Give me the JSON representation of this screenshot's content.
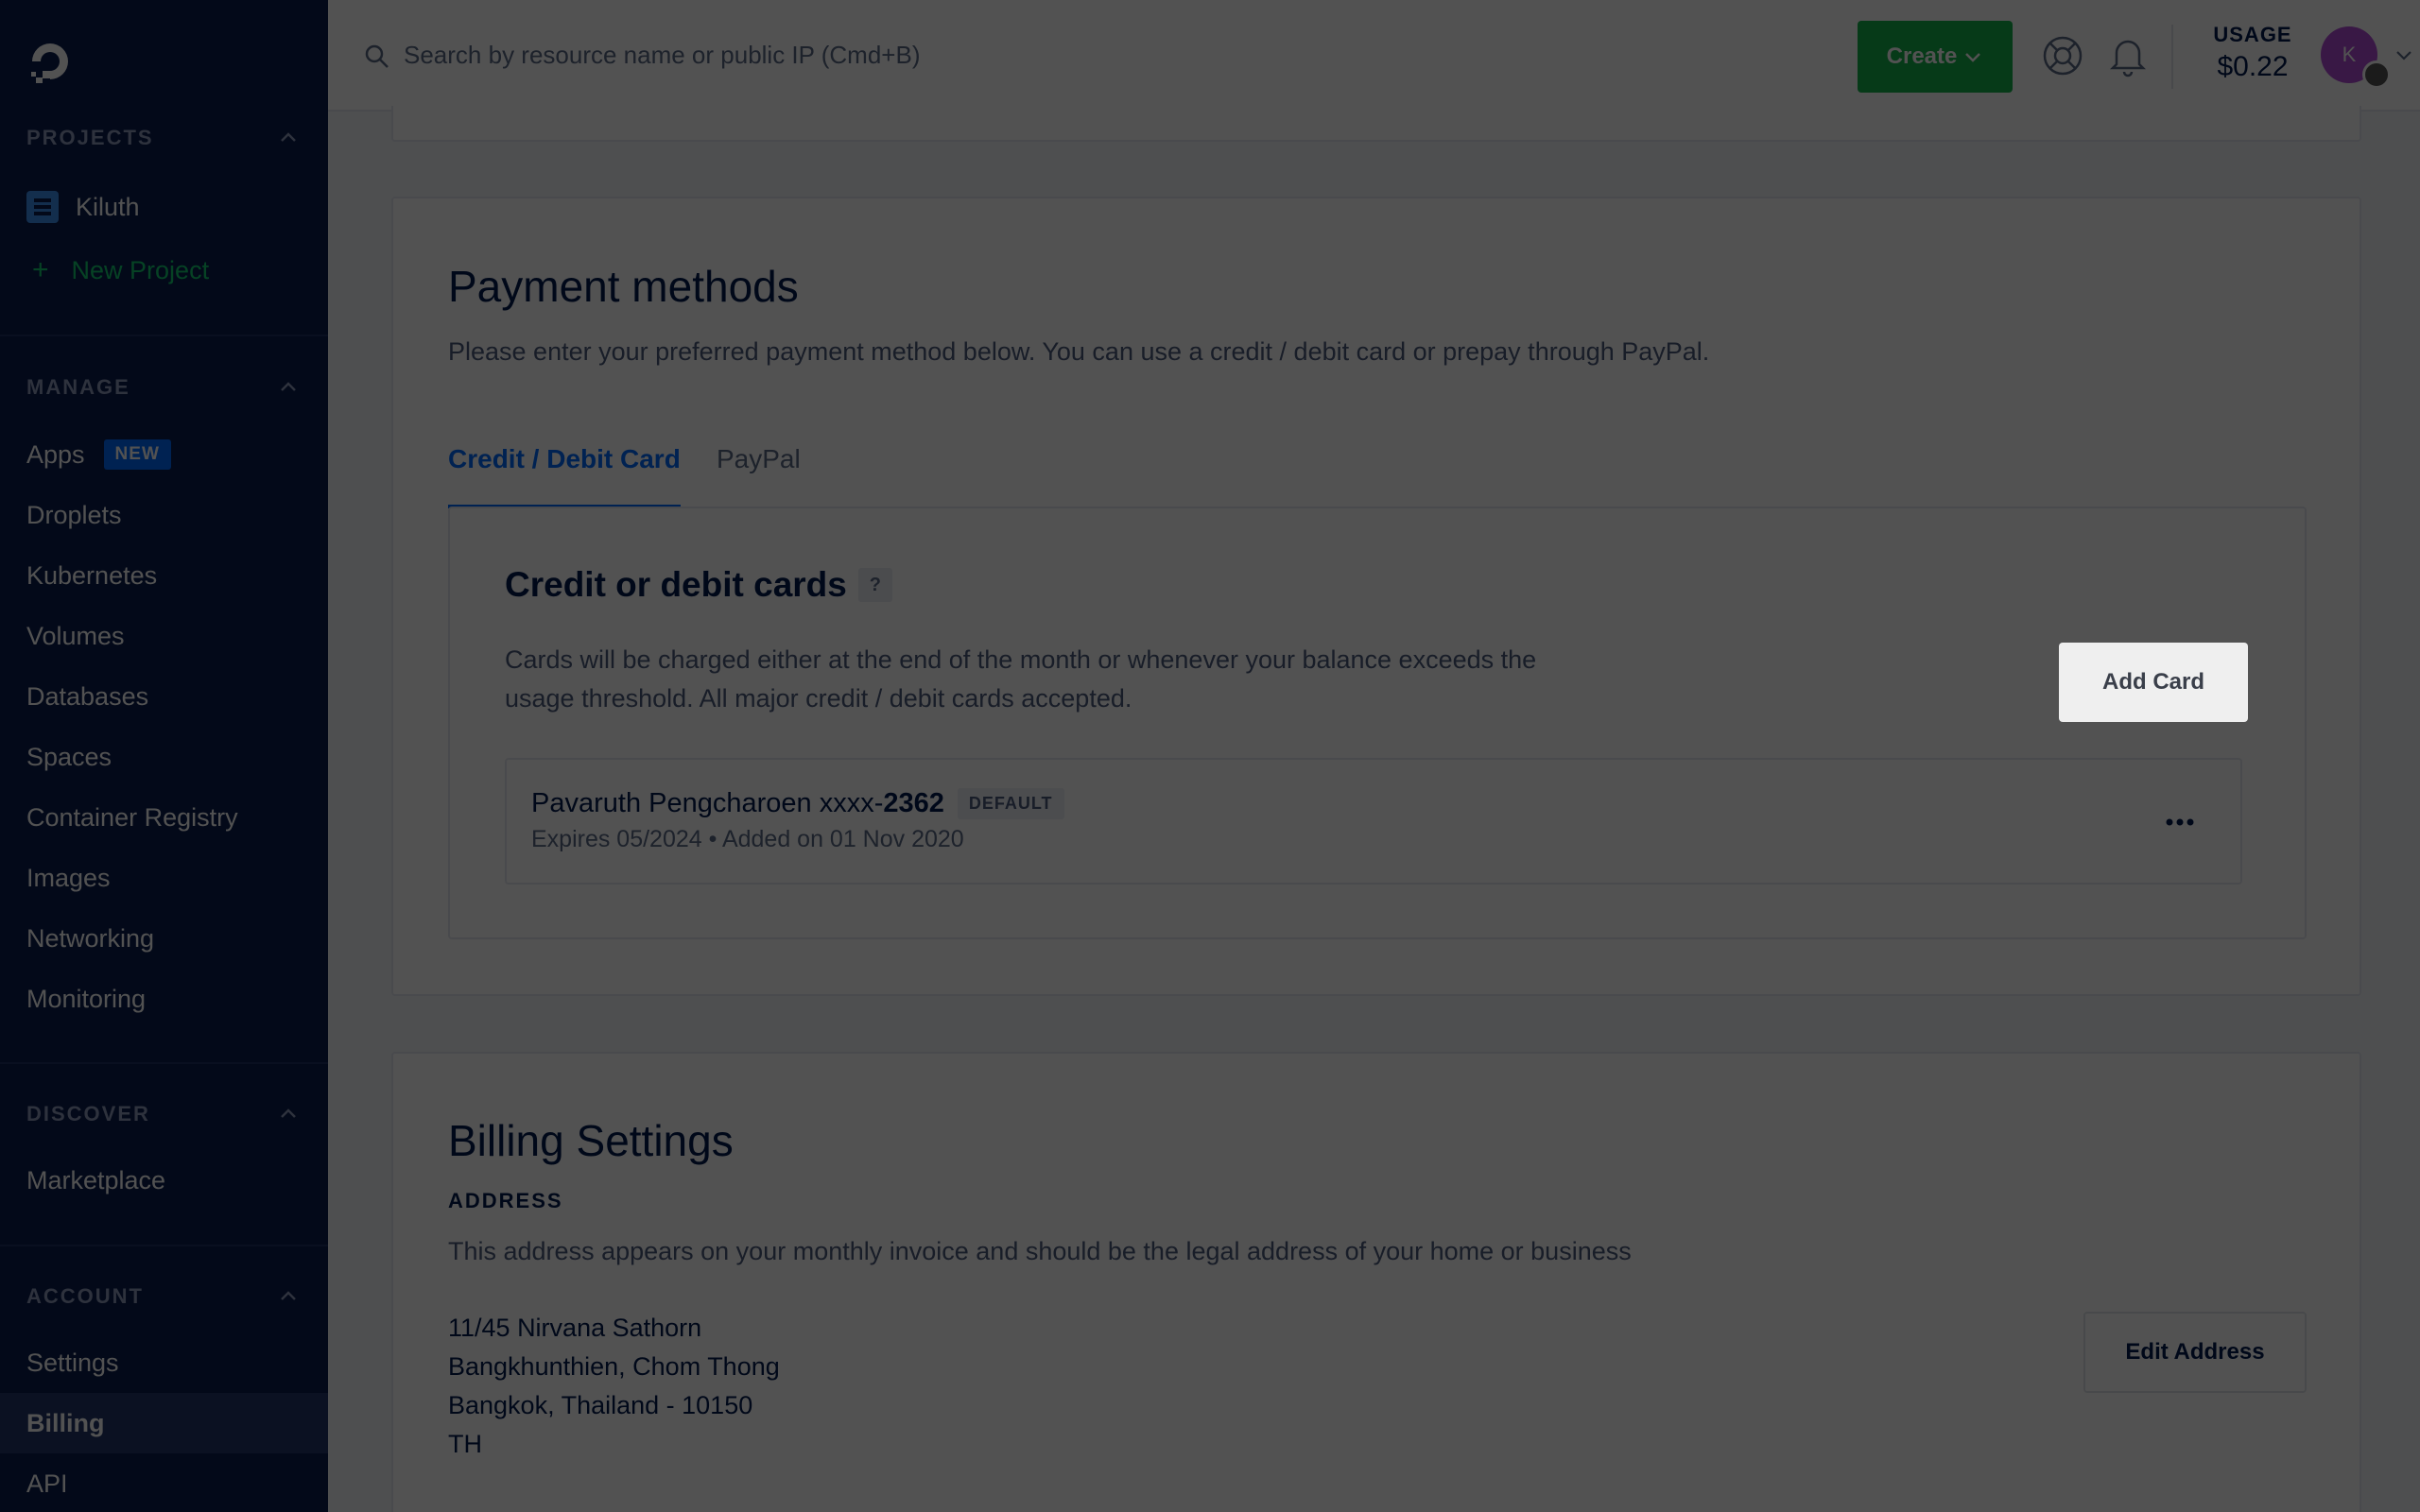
{
  "sidebar": {
    "projects_title": "PROJECTS",
    "project_name": "Kiluth",
    "new_project": "New Project",
    "new_project_plus": "+",
    "manage_title": "MANAGE",
    "manage_items": [
      "Apps",
      "Droplets",
      "Kubernetes",
      "Volumes",
      "Databases",
      "Spaces",
      "Container Registry",
      "Images",
      "Networking",
      "Monitoring"
    ],
    "new_badge": "NEW",
    "discover_title": "DISCOVER",
    "discover_items": [
      "Marketplace"
    ],
    "account_title": "ACCOUNT",
    "account_items": [
      "Settings",
      "Billing",
      "API"
    ],
    "active_item": "Billing"
  },
  "topbar": {
    "search_placeholder": "Search by resource name or public IP (Cmd+B)",
    "create_label": "Create",
    "usage_label": "USAGE",
    "usage_value": "$0.22",
    "avatar_initial": "K"
  },
  "payment": {
    "title": "Payment methods",
    "description": "Please enter your preferred payment method below. You can use a credit / debit card or prepay through PayPal.",
    "tabs": [
      "Credit / Debit Card",
      "PayPal"
    ],
    "active_tab": "Credit / Debit Card",
    "cards_title": "Credit or debit cards",
    "cards_help": "?",
    "cards_desc_line1": "Cards will be charged either at the end of the month or whenever your balance exceeds the",
    "cards_desc_line2": "usage threshold. All major credit / debit cards accepted.",
    "add_card": "Add Card",
    "card": {
      "holder": "Pavaruth Pengcharoen xxxx-",
      "last4": "2362",
      "badge": "DEFAULT",
      "meta": "Expires 05/2024 • Added on 01 Nov 2020"
    }
  },
  "billing": {
    "title": "Billing Settings",
    "address_label": "ADDRESS",
    "address_desc": "This address appears on your monthly invoice and should be the legal address of your home or business",
    "address_lines": [
      "11/45 Nirvana Sathorn",
      "Bangkhunthien, Chom Thong",
      "Bangkok, Thailand - 10150",
      "TH"
    ],
    "edit_address": "Edit Address"
  },
  "colors": {
    "sidebar_bg": "#0a1d4f",
    "accent_blue": "#0069ff",
    "create_green": "#15b34d",
    "new_project_green": "#15cd72",
    "avatar_purple": "#b04bd6"
  }
}
